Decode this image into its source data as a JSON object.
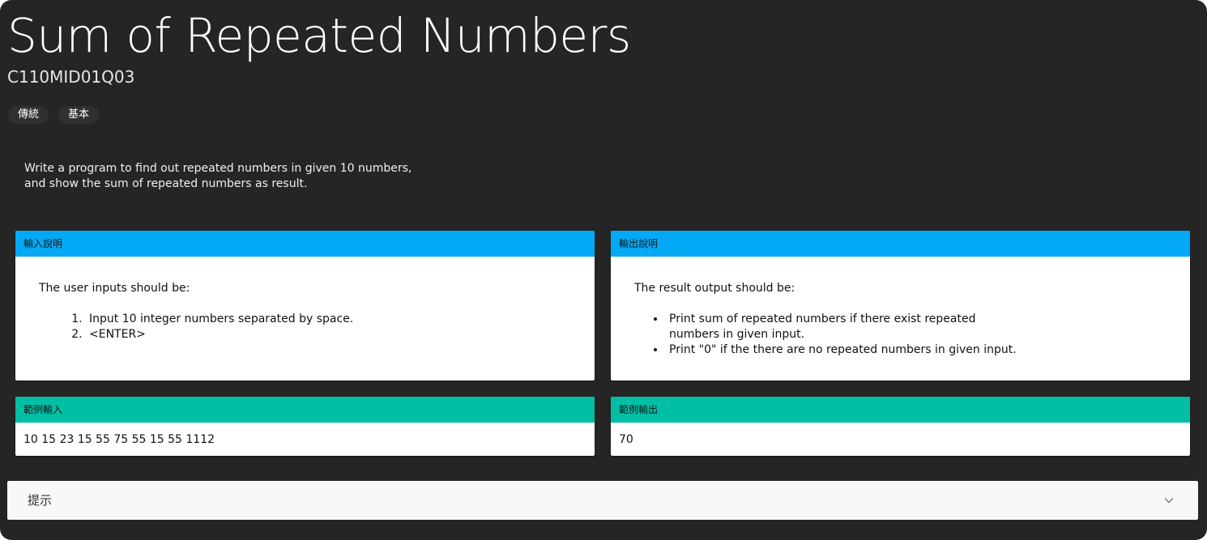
{
  "problem": {
    "title": "Sum of Repeated Numbers",
    "code": "C110MID01Q03",
    "tags": [
      "傳統",
      "基本"
    ],
    "description": "Write a program to find out repeated numbers in given 10 numbers,\nand show the sum of repeated numbers as result."
  },
  "input_section": {
    "header": "輸入說明",
    "intro": "The user inputs should be:",
    "items": [
      "Input 10 integer numbers separated by space.",
      "<ENTER>"
    ]
  },
  "output_section": {
    "header": "輸出說明",
    "intro": "The result output should be:",
    "items": [
      "Print sum of repeated numbers if there exist repeated numbers in given input.",
      "Print \"0\" if the there are no repeated numbers in given input."
    ]
  },
  "sample_input": {
    "header": "範例輸入",
    "value": "10 15 23 15 55 75 55 15 55 1112"
  },
  "sample_output": {
    "header": "範例輸出",
    "value": "70"
  },
  "hint": {
    "label": "提示",
    "icon": "chevron-down-icon"
  },
  "colors": {
    "background": "#252525",
    "io_header": "#03a9f4",
    "sample_header": "#00bfa5"
  }
}
